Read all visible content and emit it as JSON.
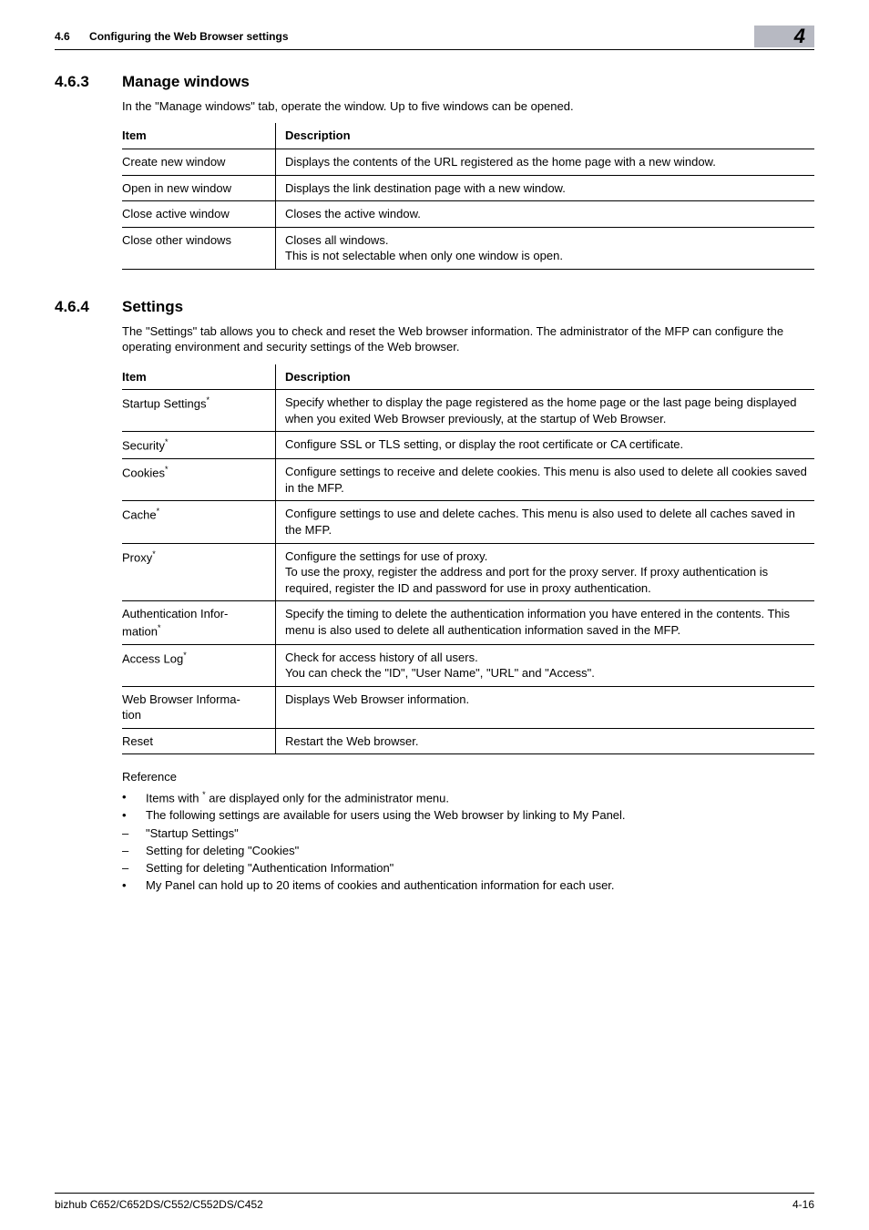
{
  "header": {
    "section_number": "4.6",
    "section_title": "Configuring the Web Browser settings",
    "chapter_badge": "4"
  },
  "section_463": {
    "number": "4.6.3",
    "title": "Manage windows",
    "intro": "In the \"Manage windows\" tab, operate the window. Up to five windows can be opened.",
    "table": {
      "header_item": "Item",
      "header_desc": "Description",
      "rows": [
        {
          "item": "Create new window",
          "desc": "Displays the contents of the URL registered as the home page with a new window."
        },
        {
          "item": "Open in new window",
          "desc": "Displays the link destination page with a new window."
        },
        {
          "item": "Close active window",
          "desc": "Closes the active window."
        },
        {
          "item": "Close other windows",
          "desc": "Closes all windows.\nThis is not selectable when only one window is open."
        }
      ]
    }
  },
  "section_464": {
    "number": "4.6.4",
    "title": "Settings",
    "intro": "The \"Settings\" tab allows you to check and reset the Web browser information. The administrator of the MFP can configure the operating environment and security settings of the Web browser.",
    "table": {
      "header_item": "Item",
      "header_desc": "Description",
      "rows": [
        {
          "item": "Startup Settings",
          "star": true,
          "desc": "Specify whether to display the page registered as the home page or the last page being displayed when you exited Web Browser previously, at the startup of Web Browser."
        },
        {
          "item": "Security",
          "star": true,
          "desc": "Configure SSL or TLS setting, or display the root certificate or CA certificate."
        },
        {
          "item": "Cookies",
          "star": true,
          "desc": "Configure settings to receive and delete cookies. This menu is also used to delete all cookies saved in the MFP."
        },
        {
          "item": "Cache",
          "star": true,
          "desc": "Configure settings to use and delete caches. This menu is also used to delete all caches saved in the MFP."
        },
        {
          "item": "Proxy",
          "star": true,
          "desc": "Configure the settings for use of proxy.\nTo use the proxy, register the address and port for the proxy server. If proxy authentication is required, register the ID and password for use in proxy authentication."
        },
        {
          "item": "Authentication Information",
          "star": true,
          "desc": "Specify the timing to delete the authentication information you have entered in the contents. This menu is also used to delete all authentication information saved in the MFP."
        },
        {
          "item": "Access Log",
          "star": true,
          "desc": "Check for access history of all users.\nYou can check the \"ID\", \"User Name\", \"URL\" and \"Access\"."
        },
        {
          "item": "Web Browser Information",
          "star": false,
          "desc": "Displays Web Browser information."
        },
        {
          "item": "Reset",
          "star": false,
          "desc": "Restart the Web browser."
        }
      ]
    },
    "reference": {
      "title": "Reference",
      "items": [
        {
          "bullet": "•",
          "text_pre": "Items with ",
          "star_mark": "*",
          "text_post": " are displayed only for the administrator menu."
        },
        {
          "bullet": "•",
          "text": "The following settings are available for users using the Web browser by linking to My Panel."
        },
        {
          "bullet": "–",
          "text": "\"Startup Settings\""
        },
        {
          "bullet": "–",
          "text": "Setting for deleting \"Cookies\""
        },
        {
          "bullet": "–",
          "text": "Setting for deleting \"Authentication Information\""
        },
        {
          "bullet": "•",
          "text": "My Panel can hold up to 20 items of cookies and authentication information for each user."
        }
      ]
    }
  },
  "footer": {
    "left": "bizhub C652/C652DS/C552/C552DS/C452",
    "right": "4-16"
  }
}
